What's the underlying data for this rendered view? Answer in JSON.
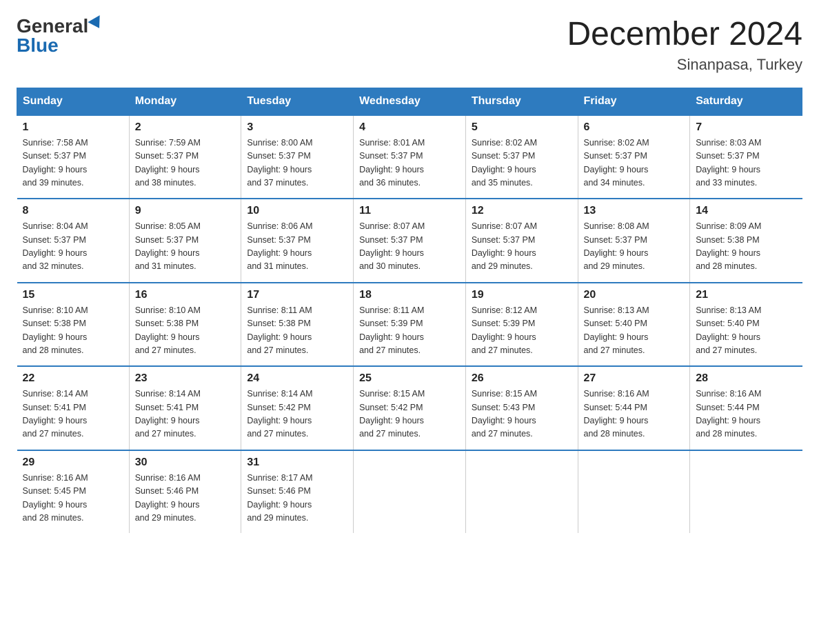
{
  "header": {
    "logo_general": "General",
    "logo_blue": "Blue",
    "title": "December 2024",
    "subtitle": "Sinanpasa, Turkey"
  },
  "days_of_week": [
    "Sunday",
    "Monday",
    "Tuesday",
    "Wednesday",
    "Thursday",
    "Friday",
    "Saturday"
  ],
  "weeks": [
    [
      {
        "num": "1",
        "sunrise": "7:58 AM",
        "sunset": "5:37 PM",
        "daylight": "9 hours and 39 minutes."
      },
      {
        "num": "2",
        "sunrise": "7:59 AM",
        "sunset": "5:37 PM",
        "daylight": "9 hours and 38 minutes."
      },
      {
        "num": "3",
        "sunrise": "8:00 AM",
        "sunset": "5:37 PM",
        "daylight": "9 hours and 37 minutes."
      },
      {
        "num": "4",
        "sunrise": "8:01 AM",
        "sunset": "5:37 PM",
        "daylight": "9 hours and 36 minutes."
      },
      {
        "num": "5",
        "sunrise": "8:02 AM",
        "sunset": "5:37 PM",
        "daylight": "9 hours and 35 minutes."
      },
      {
        "num": "6",
        "sunrise": "8:02 AM",
        "sunset": "5:37 PM",
        "daylight": "9 hours and 34 minutes."
      },
      {
        "num": "7",
        "sunrise": "8:03 AM",
        "sunset": "5:37 PM",
        "daylight": "9 hours and 33 minutes."
      }
    ],
    [
      {
        "num": "8",
        "sunrise": "8:04 AM",
        "sunset": "5:37 PM",
        "daylight": "9 hours and 32 minutes."
      },
      {
        "num": "9",
        "sunrise": "8:05 AM",
        "sunset": "5:37 PM",
        "daylight": "9 hours and 31 minutes."
      },
      {
        "num": "10",
        "sunrise": "8:06 AM",
        "sunset": "5:37 PM",
        "daylight": "9 hours and 31 minutes."
      },
      {
        "num": "11",
        "sunrise": "8:07 AM",
        "sunset": "5:37 PM",
        "daylight": "9 hours and 30 minutes."
      },
      {
        "num": "12",
        "sunrise": "8:07 AM",
        "sunset": "5:37 PM",
        "daylight": "9 hours and 29 minutes."
      },
      {
        "num": "13",
        "sunrise": "8:08 AM",
        "sunset": "5:37 PM",
        "daylight": "9 hours and 29 minutes."
      },
      {
        "num": "14",
        "sunrise": "8:09 AM",
        "sunset": "5:38 PM",
        "daylight": "9 hours and 28 minutes."
      }
    ],
    [
      {
        "num": "15",
        "sunrise": "8:10 AM",
        "sunset": "5:38 PM",
        "daylight": "9 hours and 28 minutes."
      },
      {
        "num": "16",
        "sunrise": "8:10 AM",
        "sunset": "5:38 PM",
        "daylight": "9 hours and 27 minutes."
      },
      {
        "num": "17",
        "sunrise": "8:11 AM",
        "sunset": "5:38 PM",
        "daylight": "9 hours and 27 minutes."
      },
      {
        "num": "18",
        "sunrise": "8:11 AM",
        "sunset": "5:39 PM",
        "daylight": "9 hours and 27 minutes."
      },
      {
        "num": "19",
        "sunrise": "8:12 AM",
        "sunset": "5:39 PM",
        "daylight": "9 hours and 27 minutes."
      },
      {
        "num": "20",
        "sunrise": "8:13 AM",
        "sunset": "5:40 PM",
        "daylight": "9 hours and 27 minutes."
      },
      {
        "num": "21",
        "sunrise": "8:13 AM",
        "sunset": "5:40 PM",
        "daylight": "9 hours and 27 minutes."
      }
    ],
    [
      {
        "num": "22",
        "sunrise": "8:14 AM",
        "sunset": "5:41 PM",
        "daylight": "9 hours and 27 minutes."
      },
      {
        "num": "23",
        "sunrise": "8:14 AM",
        "sunset": "5:41 PM",
        "daylight": "9 hours and 27 minutes."
      },
      {
        "num": "24",
        "sunrise": "8:14 AM",
        "sunset": "5:42 PM",
        "daylight": "9 hours and 27 minutes."
      },
      {
        "num": "25",
        "sunrise": "8:15 AM",
        "sunset": "5:42 PM",
        "daylight": "9 hours and 27 minutes."
      },
      {
        "num": "26",
        "sunrise": "8:15 AM",
        "sunset": "5:43 PM",
        "daylight": "9 hours and 27 minutes."
      },
      {
        "num": "27",
        "sunrise": "8:16 AM",
        "sunset": "5:44 PM",
        "daylight": "9 hours and 28 minutes."
      },
      {
        "num": "28",
        "sunrise": "8:16 AM",
        "sunset": "5:44 PM",
        "daylight": "9 hours and 28 minutes."
      }
    ],
    [
      {
        "num": "29",
        "sunrise": "8:16 AM",
        "sunset": "5:45 PM",
        "daylight": "9 hours and 28 minutes."
      },
      {
        "num": "30",
        "sunrise": "8:16 AM",
        "sunset": "5:46 PM",
        "daylight": "9 hours and 29 minutes."
      },
      {
        "num": "31",
        "sunrise": "8:17 AM",
        "sunset": "5:46 PM",
        "daylight": "9 hours and 29 minutes."
      },
      null,
      null,
      null,
      null
    ]
  ],
  "labels": {
    "sunrise": "Sunrise:",
    "sunset": "Sunset:",
    "daylight": "Daylight:"
  }
}
